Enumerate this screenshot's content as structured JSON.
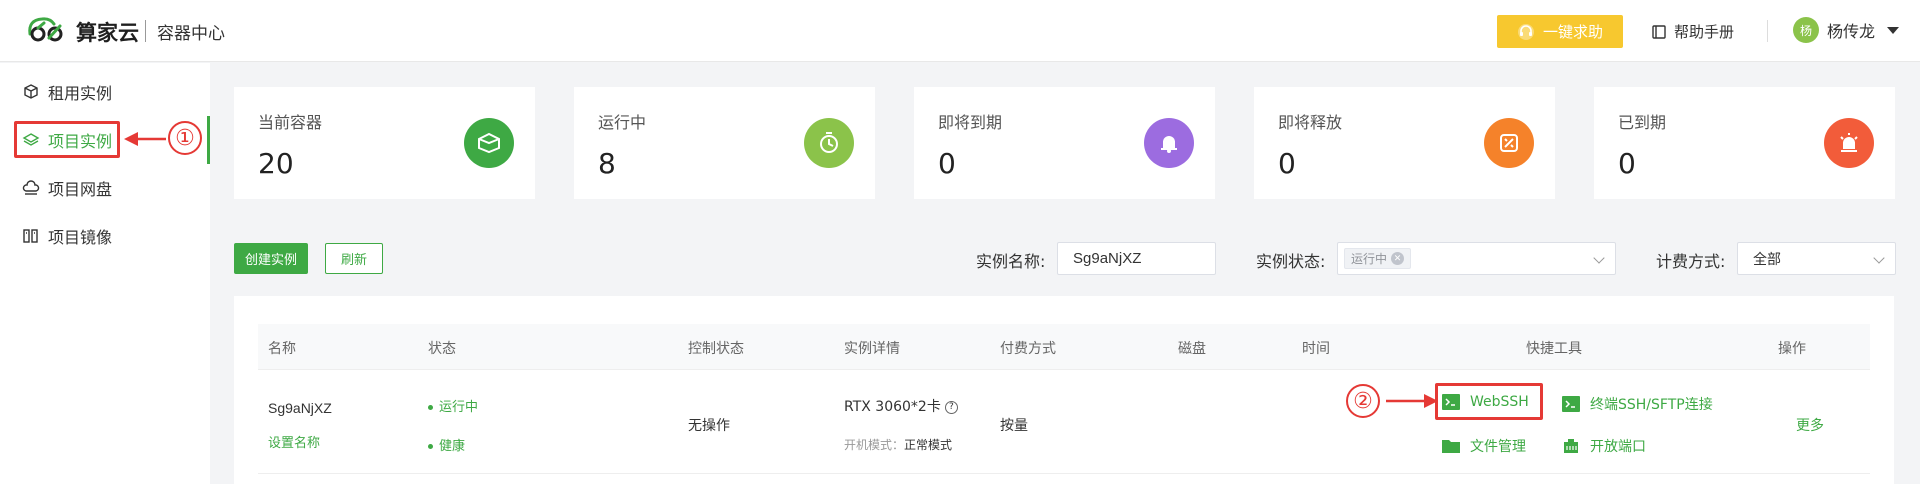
{
  "header": {
    "brand": "算家云",
    "product": "容器中心",
    "help_button": "一键求助",
    "manual": "帮助手册",
    "user_name": "杨传龙",
    "avatar_text": "杨"
  },
  "sidebar": {
    "items": [
      {
        "label": "租用实例"
      },
      {
        "label": "项目实例"
      },
      {
        "label": "项目网盘"
      },
      {
        "label": "项目镜像"
      }
    ]
  },
  "annotations": {
    "one": "①",
    "two": "②"
  },
  "stats": [
    {
      "label": "当前容器",
      "value": "20",
      "color": "#3ea944"
    },
    {
      "label": "运行中",
      "value": "8",
      "color": "#8bc34a"
    },
    {
      "label": "即将到期",
      "value": "0",
      "color": "#9c6ce0"
    },
    {
      "label": "即将释放",
      "value": "0",
      "color": "#f5822a"
    },
    {
      "label": "已到期",
      "value": "0",
      "color": "#f25c3a"
    }
  ],
  "toolbar": {
    "create_label": "创建实例",
    "refresh_label": "刷新",
    "name_label": "实例名称:",
    "name_value": "Sg9aNjXZ",
    "status_label": "实例状态:",
    "status_tag": "运行中",
    "billing_label": "计费方式:",
    "billing_value": "全部"
  },
  "table": {
    "headers": [
      "名称",
      "状态",
      "控制状态",
      "实例详情",
      "付费方式",
      "磁盘",
      "时间",
      "快捷工具",
      "操作"
    ],
    "row": {
      "name": "Sg9aNjXZ",
      "set_name": "设置名称",
      "status": "运行中",
      "health": "健康",
      "control": "无操作",
      "gpu": "RTX 3060*2卡",
      "boot_mode_label": "开机模式：",
      "boot_mode_value": "正常模式",
      "billing": "按量",
      "tools": {
        "webssh": "WebSSH",
        "terminal": "终端SSH/SFTP连接",
        "files": "文件管理",
        "ports": "开放端口"
      },
      "more": "更多"
    }
  }
}
